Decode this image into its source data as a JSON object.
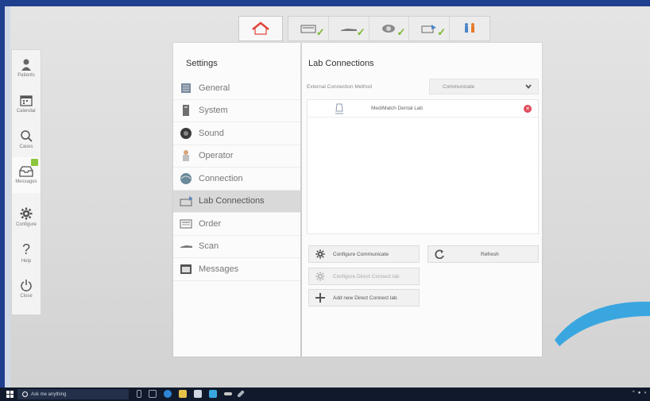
{
  "nav": {
    "items": [
      {
        "label": "Patients",
        "icon": "patient-icon"
      },
      {
        "label": "Calendar",
        "icon": "calendar-icon"
      },
      {
        "label": "Cases",
        "icon": "search-icon"
      },
      {
        "label": "Messages",
        "icon": "inbox-icon"
      },
      {
        "label": "Configure",
        "icon": "gear-icon"
      },
      {
        "label": "Help",
        "icon": "question-icon"
      },
      {
        "label": "Close",
        "icon": "power-icon"
      }
    ]
  },
  "workflow": {
    "steps": [
      "order-step-icon",
      "scan-step-icon",
      "model-step-icon",
      "send-step-icon",
      "delivery-step-icon"
    ]
  },
  "settings": {
    "title": "Settings",
    "items": [
      {
        "label": "General"
      },
      {
        "label": "System"
      },
      {
        "label": "Sound"
      },
      {
        "label": "Operator"
      },
      {
        "label": "Connection"
      },
      {
        "label": "Lab Connections"
      },
      {
        "label": "Order"
      },
      {
        "label": "Scan"
      },
      {
        "label": "Messages"
      }
    ],
    "selected": "Lab Connections"
  },
  "lab": {
    "title": "Lab Connections",
    "method_label": "External Connection Method",
    "method_value": "Communicate",
    "labs": [
      {
        "name": "MediMatch Dental Lab"
      }
    ],
    "buttons": {
      "configure_communicate": "Configure Communicate",
      "refresh": "Refresh",
      "configure_direct": "Configure Direct Connect lab",
      "add_direct": "Add new Direct Connect lab"
    }
  },
  "taskbar": {
    "search_placeholder": "Ask me anything"
  },
  "colors": {
    "accent_green": "#7ab82c",
    "delete_red": "#e04a5a",
    "frame_blue": "#1f3f8f"
  }
}
